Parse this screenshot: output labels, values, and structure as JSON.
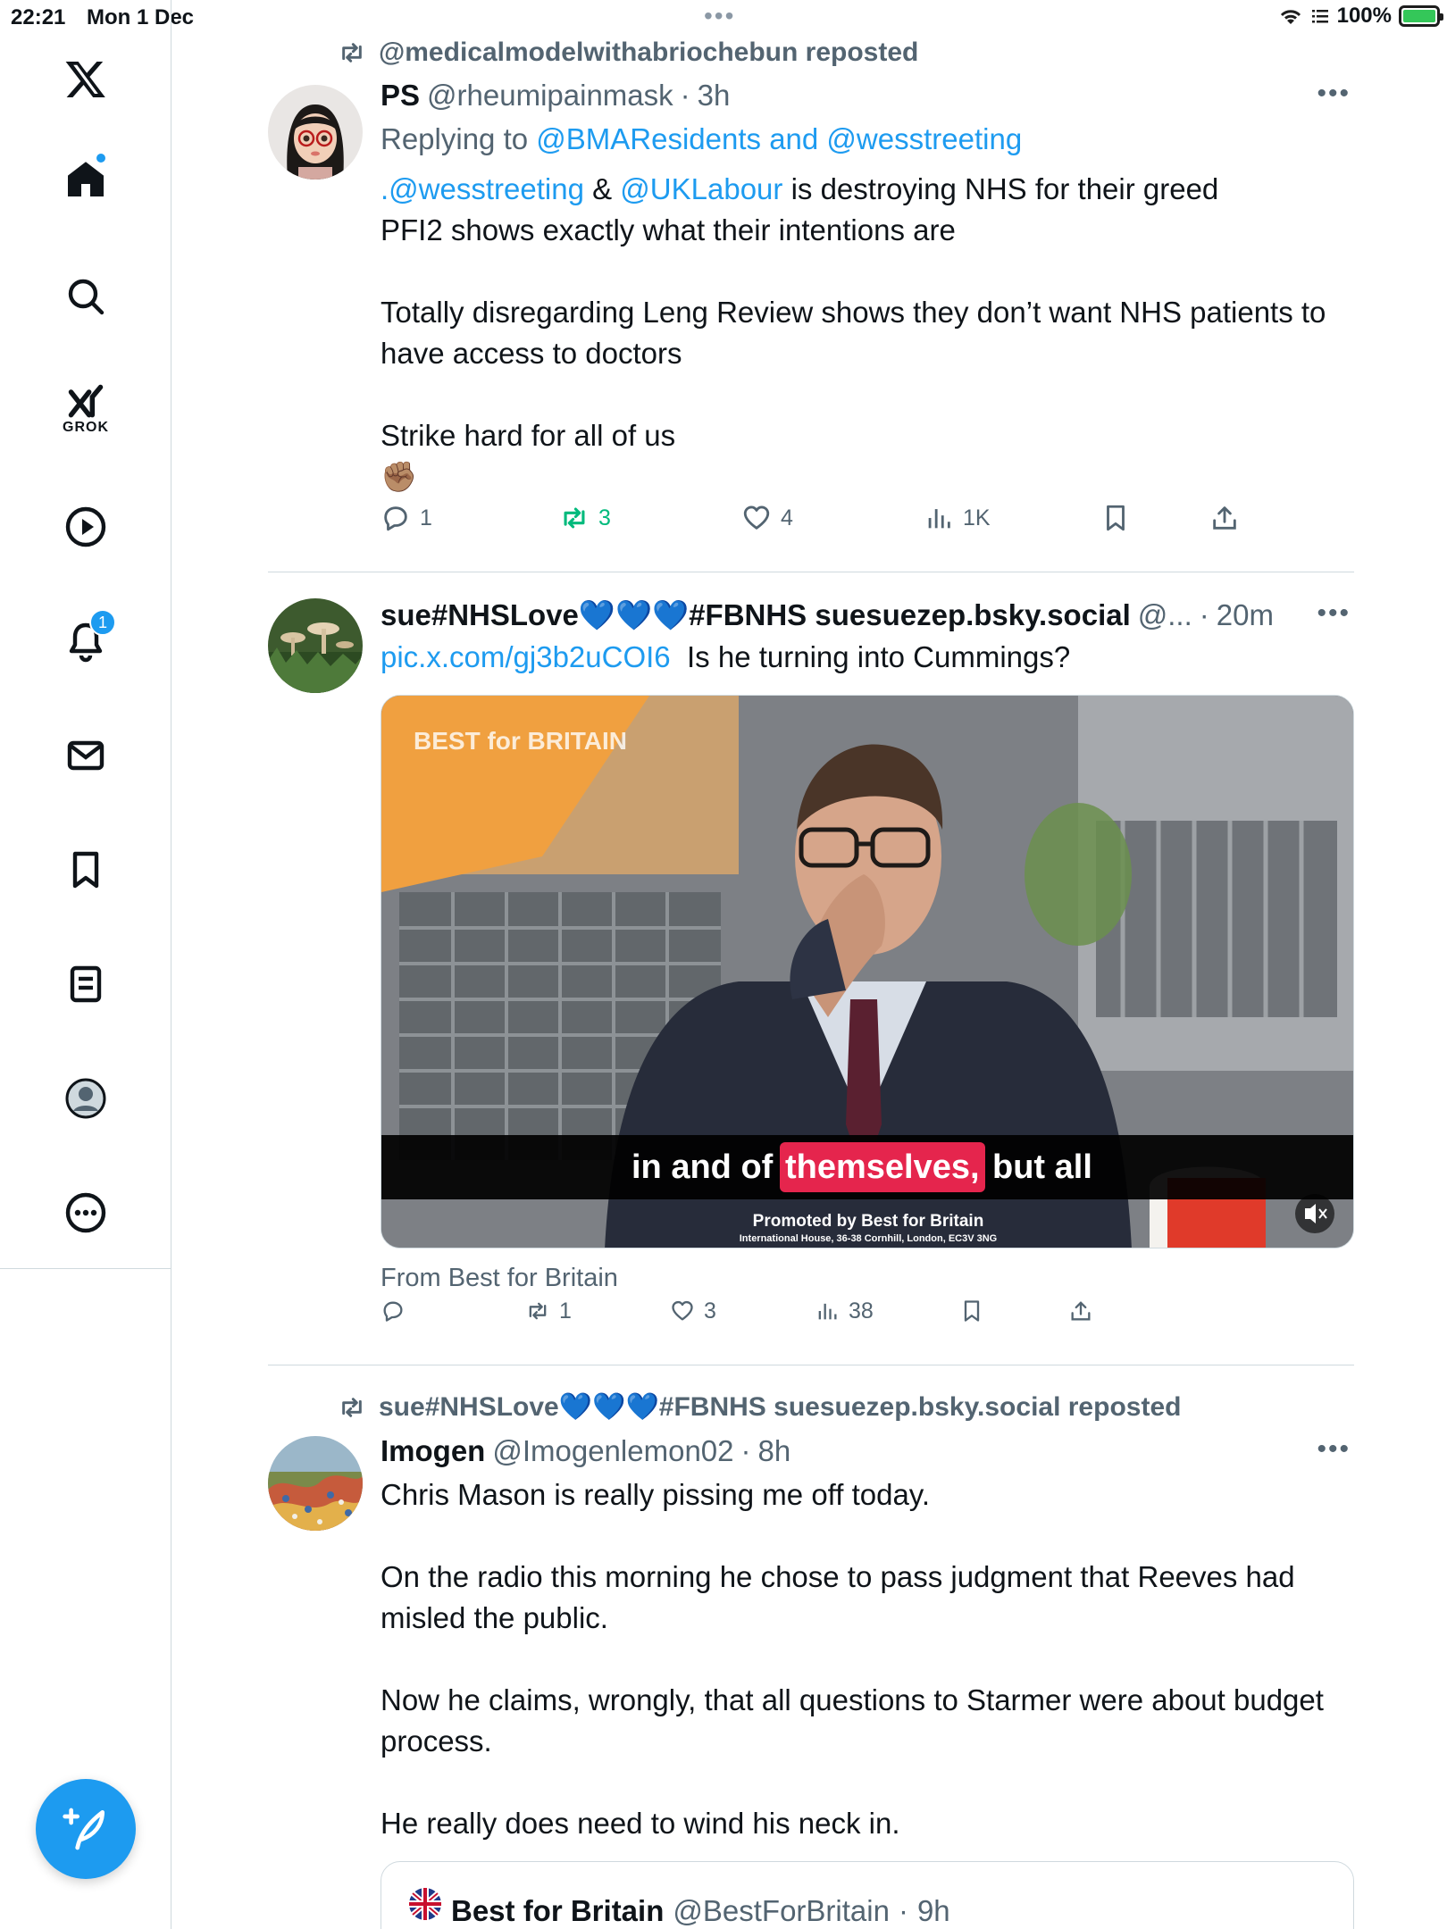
{
  "status_bar": {
    "time": "22:21",
    "date": "Mon 1 Dec",
    "battery": "100%"
  },
  "sidebar": {
    "logo": "x-logo-icon",
    "items": [
      {
        "name": "home",
        "icon": "home-icon",
        "badge": "dot"
      },
      {
        "name": "search",
        "icon": "search-icon"
      },
      {
        "name": "grok",
        "icon": "grok-icon",
        "label": "GROK"
      },
      {
        "name": "video",
        "icon": "play-icon"
      },
      {
        "name": "notifications",
        "icon": "bell-icon",
        "badge": "1"
      },
      {
        "name": "messages",
        "icon": "mail-icon"
      },
      {
        "name": "bookmarks",
        "icon": "bookmark-icon"
      },
      {
        "name": "lists",
        "icon": "list-icon"
      },
      {
        "name": "profile",
        "icon": "profile-icon"
      },
      {
        "name": "more",
        "icon": "more-circle-icon"
      }
    ],
    "compose": "compose-icon"
  },
  "tweets": [
    {
      "repost_line": "@medicalmodelwithabriochebun reposted",
      "name": "PS",
      "handle": "@rheumipainmask",
      "time": "3h",
      "reply_prefix": "Replying to",
      "reply_users": "@BMAResidents and @wesstreeting",
      "line1_mention1": ".@wesstreeting",
      "line1_amp": "&",
      "line1_mention2": "@UKLabour",
      "line1_rest": "is destroying NHS for their greed",
      "line2": "PFI2 shows exactly what their intentions are",
      "para2": "Totally disregarding Leng Review shows they don’t want NHS patients to have access to doctors",
      "para3": "Strike hard for all of us",
      "emoji": "✊🏽",
      "replies": "1",
      "reposts": "3",
      "likes": "4",
      "views": "1K"
    },
    {
      "name": "sue#NHSLove💙💙💙#FBNHS suesuezep.bsky.social",
      "handle": "@...",
      "time": "20m",
      "link": "pic.x.com/gj3b2uCOI6",
      "text": "Is he turning into Cummings?",
      "media": {
        "brand": "BEST for BRITAIN",
        "caption_pre": "in and of",
        "caption_highlight": "themselves,",
        "caption_post": "but all",
        "promoted": "Promoted by Best for Britain",
        "address": "International House, 36-38 Cornhill, London, EC3V 3NG"
      },
      "from": "From Best for Britain",
      "replies": "",
      "reposts": "1",
      "likes": "3",
      "views": "38"
    },
    {
      "repost_line": "sue#NHSLove💙💙💙#FBNHS suesuezep.bsky.social reposted",
      "name": "Imogen",
      "handle": "@Imogenlemon02",
      "time": "8h",
      "para1": "Chris Mason is really pissing me off today.",
      "para2": "On the radio this morning he chose to pass judgment that Reeves had misled the public.",
      "para3": "Now he claims, wrongly, that all questions to Starmer were about budget process.",
      "para4": "He really does need to wind his neck in.",
      "quote": {
        "name": "Best for Britain",
        "handle": "@BestForBritain",
        "time": "9h"
      }
    }
  ],
  "colors": {
    "accent": "#1d9bf0",
    "repost_green": "#00ba7c",
    "secondary_text": "#536471",
    "divider": "#cfd9de"
  }
}
